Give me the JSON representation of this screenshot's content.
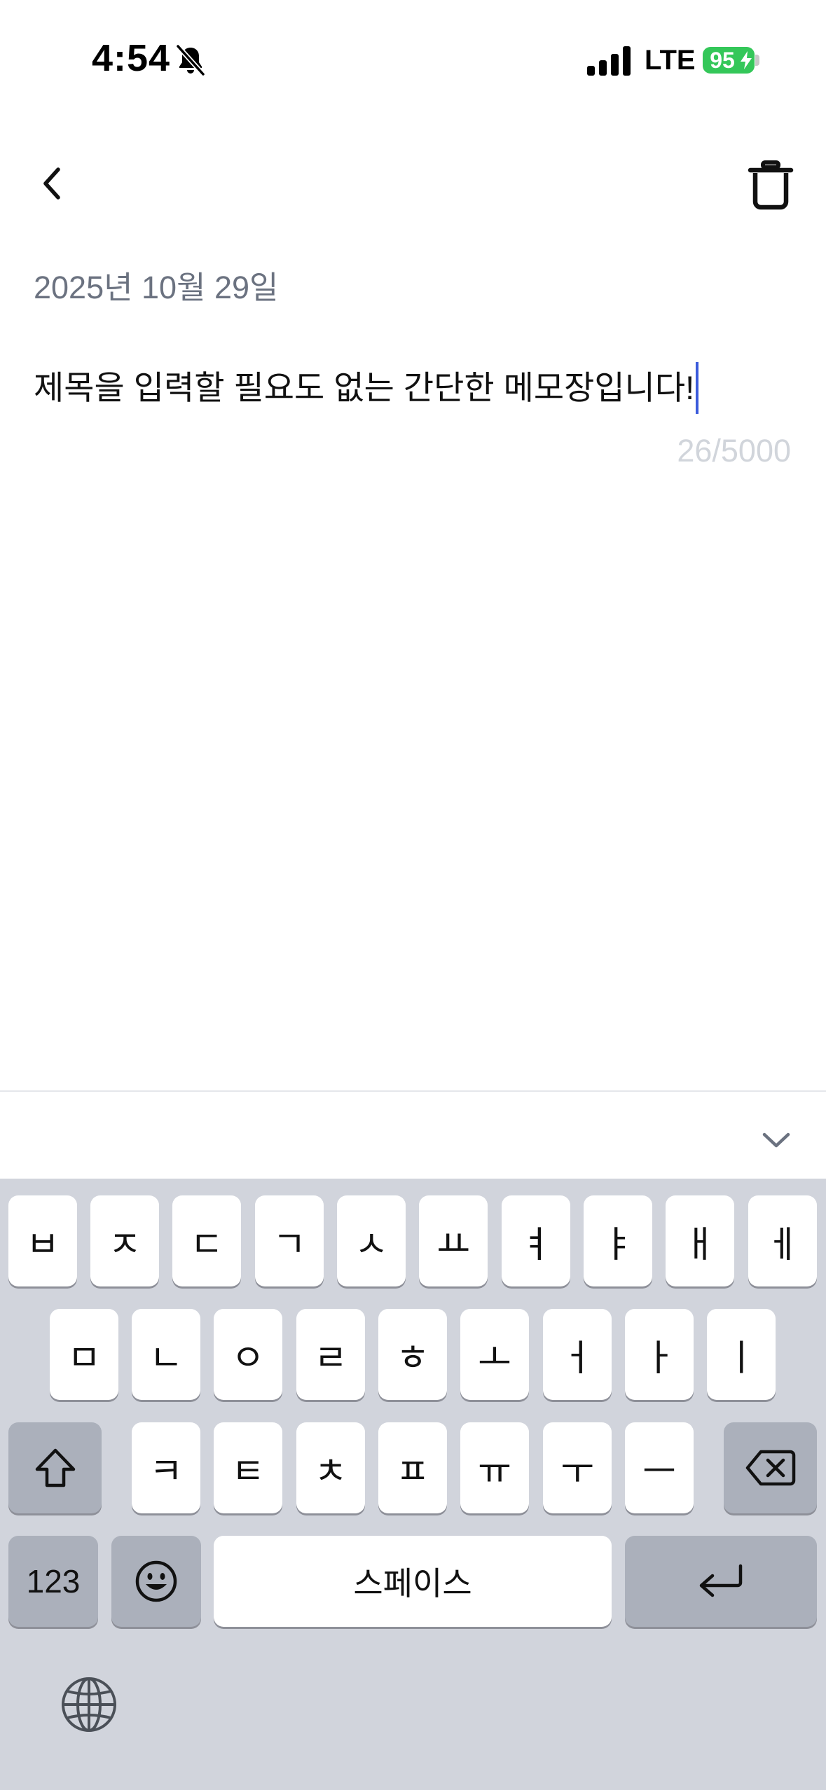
{
  "status_bar": {
    "time": "4:54",
    "network": "LTE",
    "battery": "95",
    "battery_color": "#34c759",
    "icons": [
      "bell-muted-icon",
      "signal-icon",
      "battery-icon"
    ]
  },
  "header": {
    "back_icon": "chevron-left-icon",
    "delete_icon": "trash-icon"
  },
  "memo": {
    "date": "2025년 10월 29일",
    "content": "제목을 입력할 필요도 없는 간단한 메모장입니다!",
    "char_count": "26/5000"
  },
  "toolbar": {
    "dismiss_icon": "chevron-down-icon"
  },
  "keyboard": {
    "row1": [
      "ㅂ",
      "ㅈ",
      "ㄷ",
      "ㄱ",
      "ㅅ",
      "ㅛ",
      "ㅕ",
      "ㅑ",
      "ㅐ",
      "ㅔ"
    ],
    "row2": [
      "ㅁ",
      "ㄴ",
      "ㅇ",
      "ㄹ",
      "ㅎ",
      "ㅗ",
      "ㅓ",
      "ㅏ",
      "ㅣ"
    ],
    "row3": [
      "ㅋ",
      "ㅌ",
      "ㅊ",
      "ㅍ",
      "ㅠ",
      "ㅜ",
      "ㅡ"
    ],
    "numbers_label": "123",
    "space_label": "스페이스",
    "shift_icon": "shift-icon",
    "delete_icon": "backspace-icon",
    "emoji_icon": "emoji-icon",
    "return_icon": "return-icon",
    "globe_icon": "globe-icon"
  },
  "colors": {
    "accent": "#3b5bdb",
    "keyboard_bg": "#d1d4dc",
    "date_text": "#6b7280",
    "counter_text": "#d1d5db"
  }
}
